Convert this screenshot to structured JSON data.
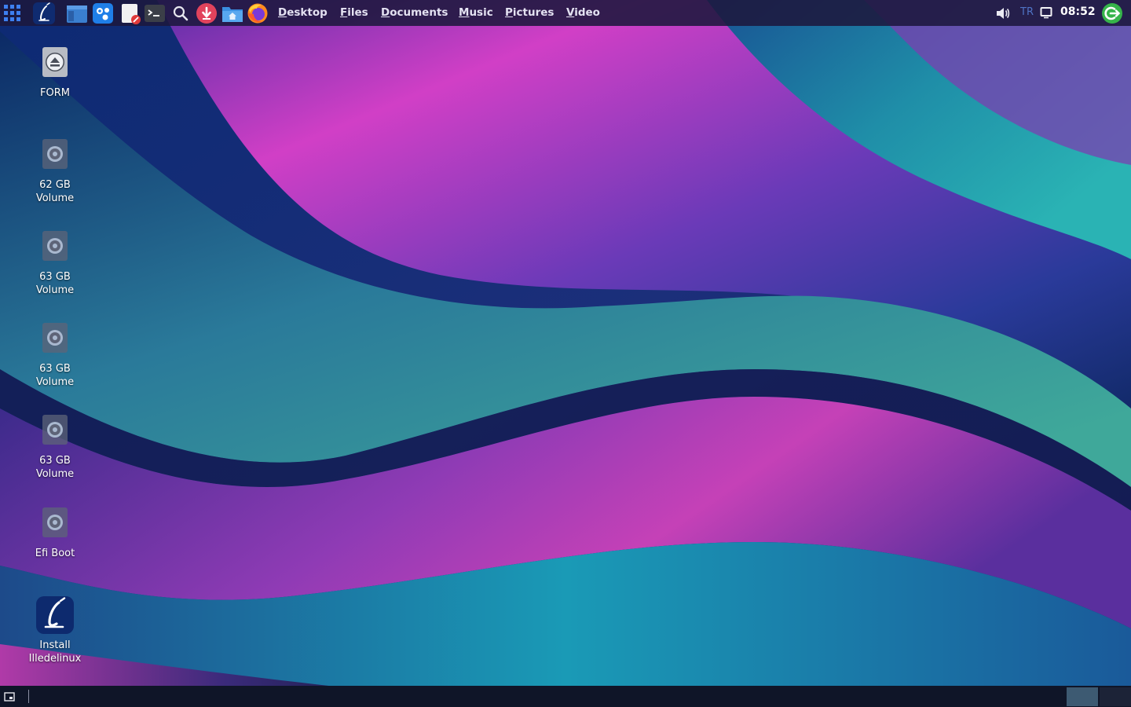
{
  "panel": {
    "launchers": [
      {
        "name": "app-grid-icon"
      },
      {
        "name": "illedelinux-menu-icon"
      },
      {
        "name": "file-manager-icon"
      },
      {
        "name": "photo-viewer-icon"
      },
      {
        "name": "text-editor-icon"
      },
      {
        "name": "terminal-icon"
      },
      {
        "name": "search-icon"
      },
      {
        "name": "downloader-icon"
      },
      {
        "name": "home-folder-icon"
      },
      {
        "name": "firefox-icon"
      }
    ],
    "places": [
      {
        "mnemonic": "D",
        "rest": "esktop"
      },
      {
        "mnemonic": "F",
        "rest": "iles"
      },
      {
        "mnemonic": "D",
        "rest": "ocuments"
      },
      {
        "mnemonic": "M",
        "rest": "usic"
      },
      {
        "mnemonic": "P",
        "rest": "ictures"
      },
      {
        "mnemonic": "V",
        "rest": "ideo"
      }
    ],
    "tray": {
      "volume_icon": "speaker-icon",
      "keyboard_layout": "TR",
      "display_icon": "display-icon",
      "clock": "08:52",
      "logout_icon": "power-exit-icon"
    }
  },
  "desktop": {
    "icons": [
      {
        "label": "FORM",
        "icon": "eject-drive-icon"
      },
      {
        "label": "62 GB\nVolume",
        "icon": "hard-drive-icon"
      },
      {
        "label": "63 GB\nVolume",
        "icon": "hard-drive-icon"
      },
      {
        "label": "63 GB\nVolume",
        "icon": "hard-drive-icon"
      },
      {
        "label": "63 GB\nVolume",
        "icon": "hard-drive-icon"
      },
      {
        "label": "Efi Boot",
        "icon": "hard-drive-icon"
      },
      {
        "label": "Install\nIlledelinux",
        "icon": "illedelinux-installer-icon"
      }
    ]
  },
  "bottom_panel": {
    "show_desktop_icon": "show-desktop-icon",
    "workspaces": [
      "workspace-1",
      "workspace-2"
    ]
  },
  "colors": {
    "panel_bg": "#1c183e",
    "accent_blue": "#2e6fd8",
    "accent_green": "#36b44a",
    "keyboard_label": "#4f73c4"
  }
}
